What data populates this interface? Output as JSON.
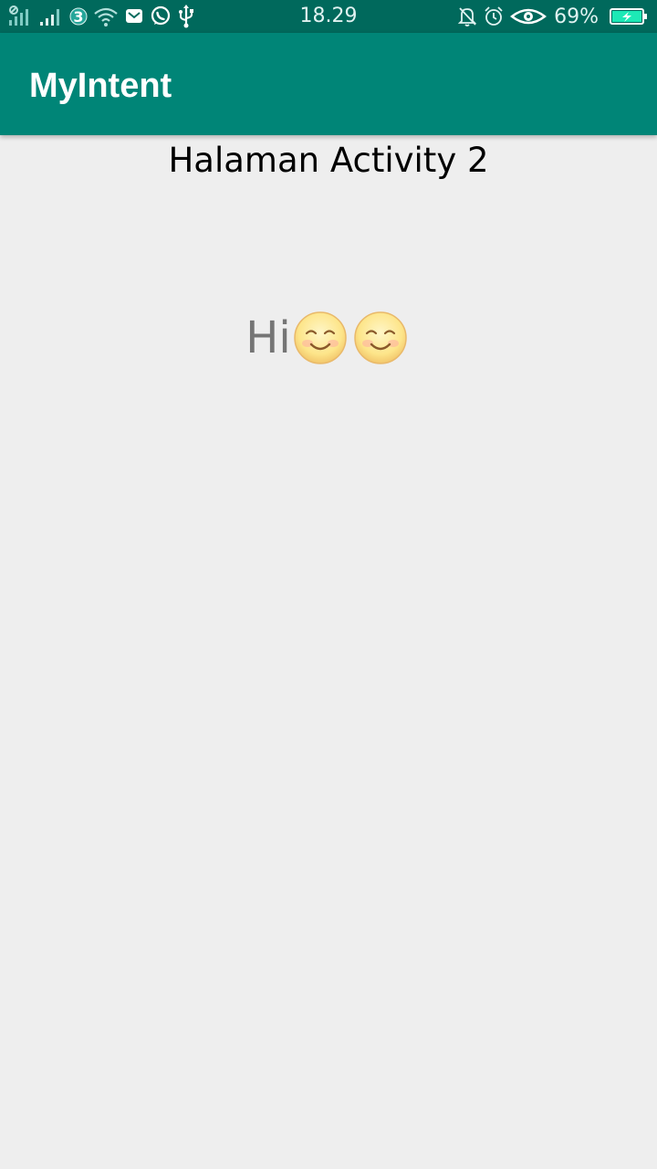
{
  "status_bar": {
    "time": "18.29",
    "battery_percent": "69%",
    "carrier_glyph": "3",
    "icons_left": [
      "signal-sim1-icon",
      "signal-sim2-icon",
      "carrier-3-icon",
      "wifi-icon",
      "gmail-icon",
      "whatsapp-icon",
      "usb-icon"
    ],
    "icons_right": [
      "notifications-muted-icon",
      "alarm-icon",
      "eye-comfort-icon",
      "battery-charging-icon"
    ]
  },
  "app_bar": {
    "title": "MyIntent",
    "color": "#008577",
    "status_color": "#00695c"
  },
  "content": {
    "heading": "Halaman Activity 2",
    "message_text": "Hi",
    "message_emojis": [
      "smiling-face-icon",
      "smiling-face-icon"
    ]
  }
}
